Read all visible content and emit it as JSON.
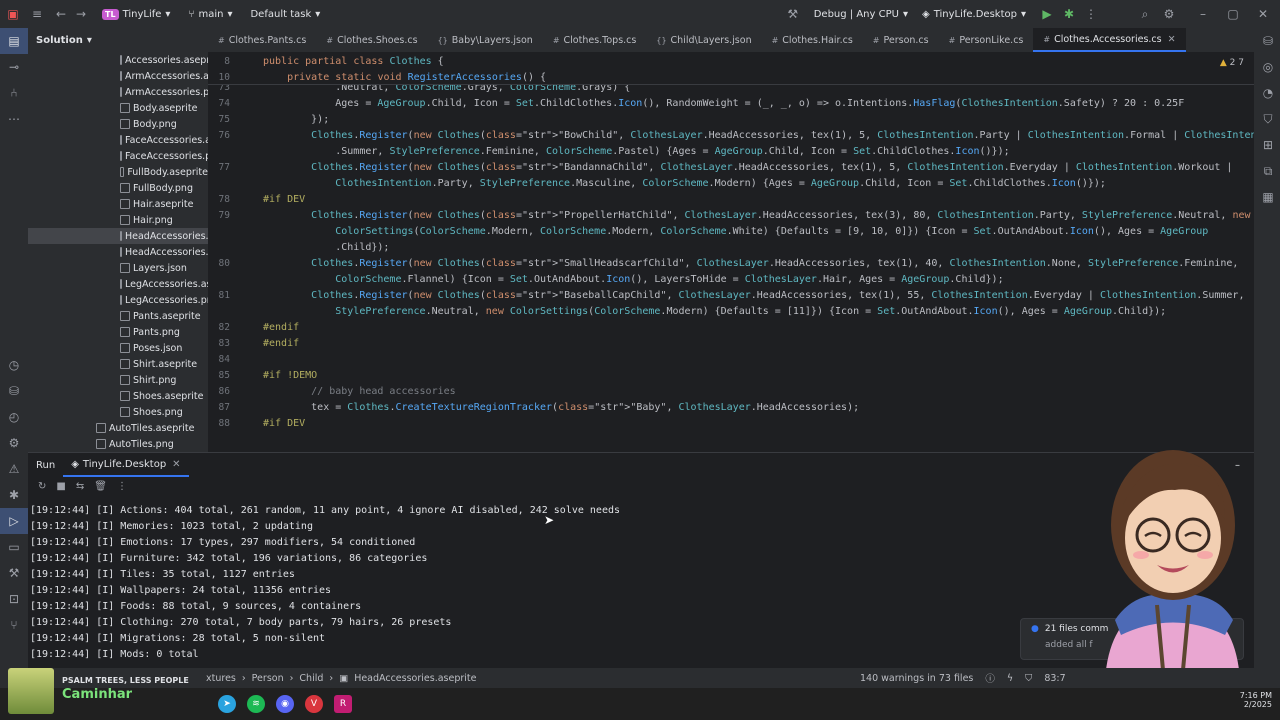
{
  "titlebar": {
    "project_badge": "TL",
    "project": "TinyLife",
    "branch": "main",
    "task": "Default task",
    "build_config": "Debug | Any CPU",
    "run_target": "TinyLife.Desktop"
  },
  "solution": {
    "title": "Solution",
    "files": [
      "Accessories.aseprite",
      "ArmAccessories.aseprite",
      "ArmAccessories.png",
      "Body.aseprite",
      "Body.png",
      "FaceAccessories.aseprite",
      "FaceAccessories.png",
      "FullBody.aseprite",
      "FullBody.png",
      "Hair.aseprite",
      "Hair.png",
      "HeadAccessories.aseprite",
      "HeadAccessories.png",
      "Layers.json",
      "LegAccessories.aseprite",
      "LegAccessories.png",
      "Pants.aseprite",
      "Pants.png",
      "Poses.json",
      "Shirt.aseprite",
      "Shirt.png",
      "Shoes.aseprite",
      "Shoes.png"
    ],
    "selected": "HeadAccessories.aseprite",
    "parent_files": [
      "AutoTiles.aseprite",
      "AutoTiles.png"
    ]
  },
  "tabs": [
    "Clothes.Pants.cs",
    "Clothes.Shoes.cs",
    "Baby\\Layers.json",
    "Clothes.Tops.cs",
    "Child\\Layers.json",
    "Clothes.Hair.cs",
    "Person.cs",
    "PersonLike.cs",
    "Clothes.Accessories.cs"
  ],
  "active_tab": "Clothes.Accessories.cs",
  "editor": {
    "sticky": [
      {
        "ln": "8",
        "text": "public partial class Clothes {"
      },
      {
        "ln": "10",
        "text": "    private static void RegisterAccessories() {"
      }
    ],
    "inspections": "2  7",
    "lines": [
      {
        "ln": "73",
        "text": "            .Neutral, ColorScheme.Grays, ColorScheme.Grays) {"
      },
      {
        "ln": "74",
        "text": "            Ages = AgeGroup.Child, Icon = Set.ChildClothes.Icon(), RandomWeight = (_, _, o) => o.Intentions.HasFlag(ClothesIntention.Safety) ? 20 : 0.25F"
      },
      {
        "ln": "75",
        "text": "        });"
      },
      {
        "ln": "76",
        "text": "        Clothes.Register(new Clothes(\"BowChild\", ClothesLayer.HeadAccessories, tex(1), 5, ClothesIntention.Party | ClothesIntention.Formal | ClothesIntention"
      },
      {
        "ln": "",
        "text": "            .Summer, StylePreference.Feminine, ColorScheme.Pastel) {Ages = AgeGroup.Child, Icon = Set.ChildClothes.Icon()});"
      },
      {
        "ln": "77",
        "text": "        Clothes.Register(new Clothes(\"BandannaChild\", ClothesLayer.HeadAccessories, tex(1), 5, ClothesIntention.Everyday | ClothesIntention.Workout |"
      },
      {
        "ln": "",
        "text": "            ClothesIntention.Party, StylePreference.Masculine, ColorScheme.Modern) {Ages = AgeGroup.Child, Icon = Set.ChildClothes.Icon()});"
      },
      {
        "ln": "78",
        "text": "#if DEV"
      },
      {
        "ln": "79",
        "text": "        Clothes.Register(new Clothes(\"PropellerHatChild\", ClothesLayer.HeadAccessories, tex(3), 80, ClothesIntention.Party, StylePreference.Neutral, new"
      },
      {
        "ln": "",
        "text": "            ColorSettings(ColorScheme.Modern, ColorScheme.Modern, ColorScheme.White) {Defaults = [9, 10, 0]}) {Icon = Set.OutAndAbout.Icon(), Ages = AgeGroup"
      },
      {
        "ln": "",
        "text": "            .Child});"
      },
      {
        "ln": "80",
        "text": "        Clothes.Register(new Clothes(\"SmallHeadscarfChild\", ClothesLayer.HeadAccessories, tex(1), 40, ClothesIntention.None, StylePreference.Feminine,"
      },
      {
        "ln": "",
        "text": "            ColorScheme.Flannel) {Icon = Set.OutAndAbout.Icon(), LayersToHide = ClothesLayer.Hair, Ages = AgeGroup.Child});"
      },
      {
        "ln": "81",
        "text": "        Clothes.Register(new Clothes(\"BaseballCapChild\", ClothesLayer.HeadAccessories, tex(1), 55, ClothesIntention.Everyday | ClothesIntention.Summer,"
      },
      {
        "ln": "",
        "text": "            StylePreference.Neutral, new ColorSettings(ColorScheme.Modern) {Defaults = [11]}) {Icon = Set.OutAndAbout.Icon(), Ages = AgeGroup.Child});"
      },
      {
        "ln": "82",
        "text": "#endif"
      },
      {
        "ln": "83",
        "text": "#endif"
      },
      {
        "ln": "84",
        "text": ""
      },
      {
        "ln": "85",
        "text": "#if !DEMO"
      },
      {
        "ln": "86",
        "text": "        // baby head accessories"
      },
      {
        "ln": "87",
        "text": "        tex = Clothes.CreateTextureRegionTracker(\"Baby\", ClothesLayer.HeadAccessories);"
      },
      {
        "ln": "88",
        "text": "#if DEV"
      }
    ]
  },
  "run": {
    "tab_run": "Run",
    "tab_target": "TinyLife.Desktop",
    "logs": [
      "[19:12:44] [I] Actions: 404 total, 261 random, 11 any point, 4 ignore AI disabled, 242 solve needs",
      "[19:12:44] [I] Memories: 1023 total, 2 updating",
      "[19:12:44] [I] Emotions: 17 types, 297 modifiers, 54 conditioned",
      "[19:12:44] [I] Furniture: 342 total, 196 variations, 86 categories",
      "[19:12:44] [I] Tiles: 35 total, 1127 entries",
      "[19:12:44] [I] Wallpapers: 24 total, 11356 entries",
      "[19:12:44] [I] Foods: 88 total, 9 sources, 4 containers",
      "[19:12:44] [I] Clothing: 270 total, 7 body parts, 79 hairs, 26 presets",
      "[19:12:44] [I] Migrations: 28 total, 5 non-silent",
      "[19:12:44] [I] Mods: 0 total"
    ]
  },
  "statusbar": {
    "breadcrumb": [
      "xtures",
      "Person",
      "Child",
      "HeadAccessories.aseprite"
    ],
    "warnings": "140 warnings in 73 files",
    "position": "83:7"
  },
  "notification": {
    "line1": "21 files comm",
    "line2": "added all f"
  },
  "taskbar": {
    "media_title": "PSALM TREES, LESS PEOPLE",
    "media_subtitle": "Caminhar",
    "time": "7:16 PM",
    "date": "2/2025"
  },
  "colors": {
    "accent": "#3574f0",
    "keyword": "#cf8e6d",
    "class": "#5fb8c2",
    "string": "#6aab73"
  }
}
